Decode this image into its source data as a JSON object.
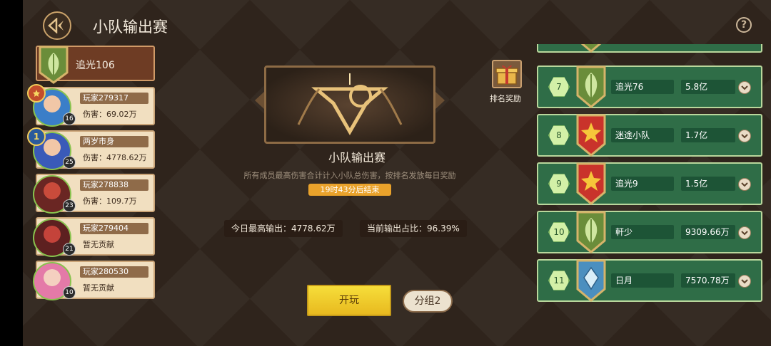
{
  "header": {
    "title": "小队输出赛",
    "help_label": "?"
  },
  "team": {
    "name": "追光106",
    "members": [
      {
        "name": "玩家279317",
        "damage": "伤害：69.02万",
        "level": "16",
        "rank": ""
      },
      {
        "name": "两岁市身",
        "damage": "伤害：4778.62万",
        "level": "25",
        "rank": "1"
      },
      {
        "name": "玩家278838",
        "damage": "伤害：109.7万",
        "level": "23",
        "rank": ""
      },
      {
        "name": "玩家279404",
        "damage": "暂无贡献",
        "level": "21",
        "rank": ""
      },
      {
        "name": "玩家280530",
        "damage": "暂无贡献",
        "level": "10",
        "rank": ""
      }
    ]
  },
  "event": {
    "title": "小队输出赛",
    "description": "所有成员最高伤害合计计入小队总伤害，按排名发放每日奖励",
    "timer": "19时43分后结束",
    "today_max": "今日最高输出：4778.62万",
    "current_ratio": "当前输出占比：96.39%",
    "play_label": "开玩",
    "group_label": "分组2"
  },
  "rewards": {
    "label": "排名奖励"
  },
  "ranking": [
    {
      "rank": "7",
      "name": "追光76",
      "value": "5.8亿",
      "emblem": "leaf"
    },
    {
      "rank": "8",
      "name": "迷途小队",
      "value": "1.7亿",
      "emblem": "star"
    },
    {
      "rank": "9",
      "name": "追光9",
      "value": "1.5亿",
      "emblem": "star"
    },
    {
      "rank": "10",
      "name": "軒少",
      "value": "9309.66万",
      "emblem": "leaf"
    },
    {
      "rank": "11",
      "name": "日月",
      "value": "7570.78万",
      "emblem": "crystal"
    }
  ],
  "colors": {
    "background": "#2f241c",
    "row_green": "#2f6d47",
    "play_yellow": "#f2d43a"
  }
}
